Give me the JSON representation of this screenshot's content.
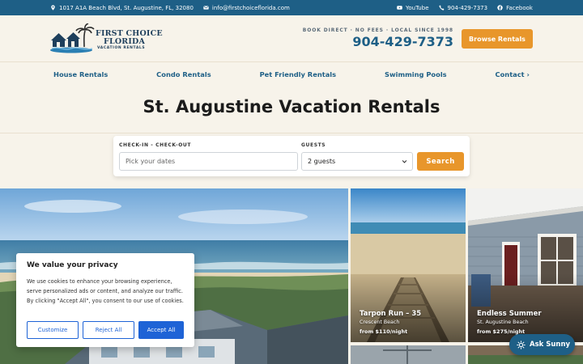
{
  "topbar": {
    "address": "1017 A1A Beach Blvd, St. Augustine, FL, 32080",
    "email": "info@firstchoiceflorida.com",
    "youtube": "YouTube",
    "phone": "904-429-7373",
    "facebook": "Facebook"
  },
  "header": {
    "logo_line1": "FIRST CHOICE",
    "logo_line2": "FLORIDA",
    "logo_tagline": "VACATION RENTALS",
    "promo_tag": "BOOK DIRECT · NO FEES · LOCAL SINCE 1998",
    "phone": "904-429-7373",
    "browse_button": "Browse Rentals"
  },
  "nav": {
    "items": [
      "House Rentals",
      "Condo Rentals",
      "Pet Friendly Rentals",
      "Swimming Pools",
      "Contact ›"
    ]
  },
  "page_title": "St. Augustine Vacation Rentals",
  "search": {
    "dates_label": "CHECK-IN - CHECK-OUT",
    "dates_placeholder": "Pick your dates",
    "guests_label": "GUESTS",
    "guests_value": "2 guests",
    "button": "Search"
  },
  "listings": [
    {
      "title": "Tarpon Run – 35",
      "location": "Crescent Beach",
      "price": "from $110/night"
    },
    {
      "title": "Endless Summer",
      "location": "St. Augustine Beach",
      "price": "from $275/night"
    }
  ],
  "cookie": {
    "title": "We value your privacy",
    "body": "We use cookies to enhance your browsing experience, serve personalized ads or content, and analyze our traffic. By clicking \"Accept All\", you consent to our use of cookies.",
    "customize": "Customize",
    "reject": "Reject All",
    "accept": "Accept All"
  },
  "chat": {
    "label": "Ask Sunny"
  },
  "colors": {
    "brand_blue": "#1e5f86",
    "accent_orange": "#e8962b",
    "consent_blue": "#1e63d6",
    "page_background": "#f7f3ea"
  },
  "icons": [
    "map-pin-icon",
    "envelope-icon",
    "youtube-icon",
    "phone-icon",
    "facebook-icon",
    "chevron-down-icon",
    "sun-icon"
  ]
}
